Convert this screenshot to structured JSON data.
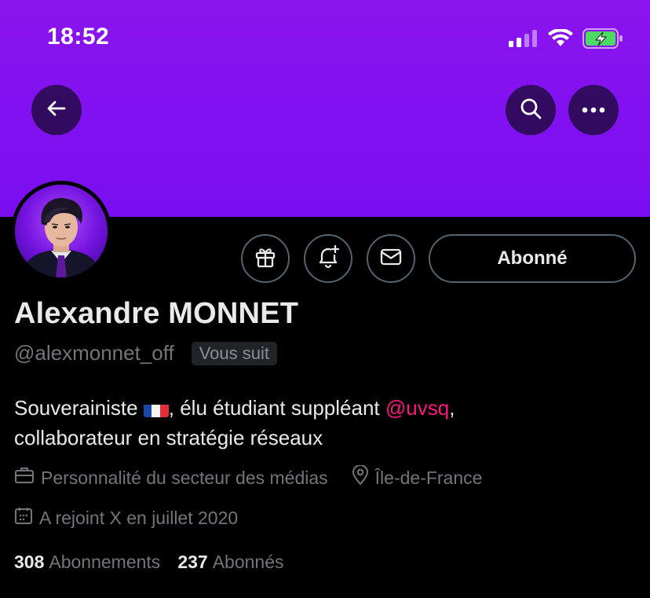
{
  "status_bar": {
    "time": "18:52"
  },
  "colors": {
    "banner": "#8a14ee",
    "mention": "#f91880",
    "battery_fill": "#4cd964"
  },
  "header": {
    "back_icon": "arrow-left-icon",
    "search_icon": "search-icon",
    "more_icon": "more-horizontal-icon"
  },
  "actions": {
    "gift_icon": "gift-icon",
    "notify_icon": "bell-plus-icon",
    "message_icon": "mail-icon",
    "follow_label": "Abonné"
  },
  "profile": {
    "display_name": "Alexandre MONNET",
    "handle": "@alexmonnet_off",
    "follows_you": "Vous suit",
    "bio_part1": "Souverainiste ",
    "bio_part2": ", élu étudiant suppléant ",
    "bio_mention": "@uvsq",
    "bio_part3": ",",
    "bio_line2": "collaborateur en stratégie réseaux",
    "category": "Personnalité du secteur des médias",
    "location": "Île-de-France",
    "joined": "A rejoint X en juillet 2020"
  },
  "stats": {
    "following_count": "308",
    "following_label": "Abonnements",
    "followers_count": "237",
    "followers_label": "Abonnés"
  }
}
